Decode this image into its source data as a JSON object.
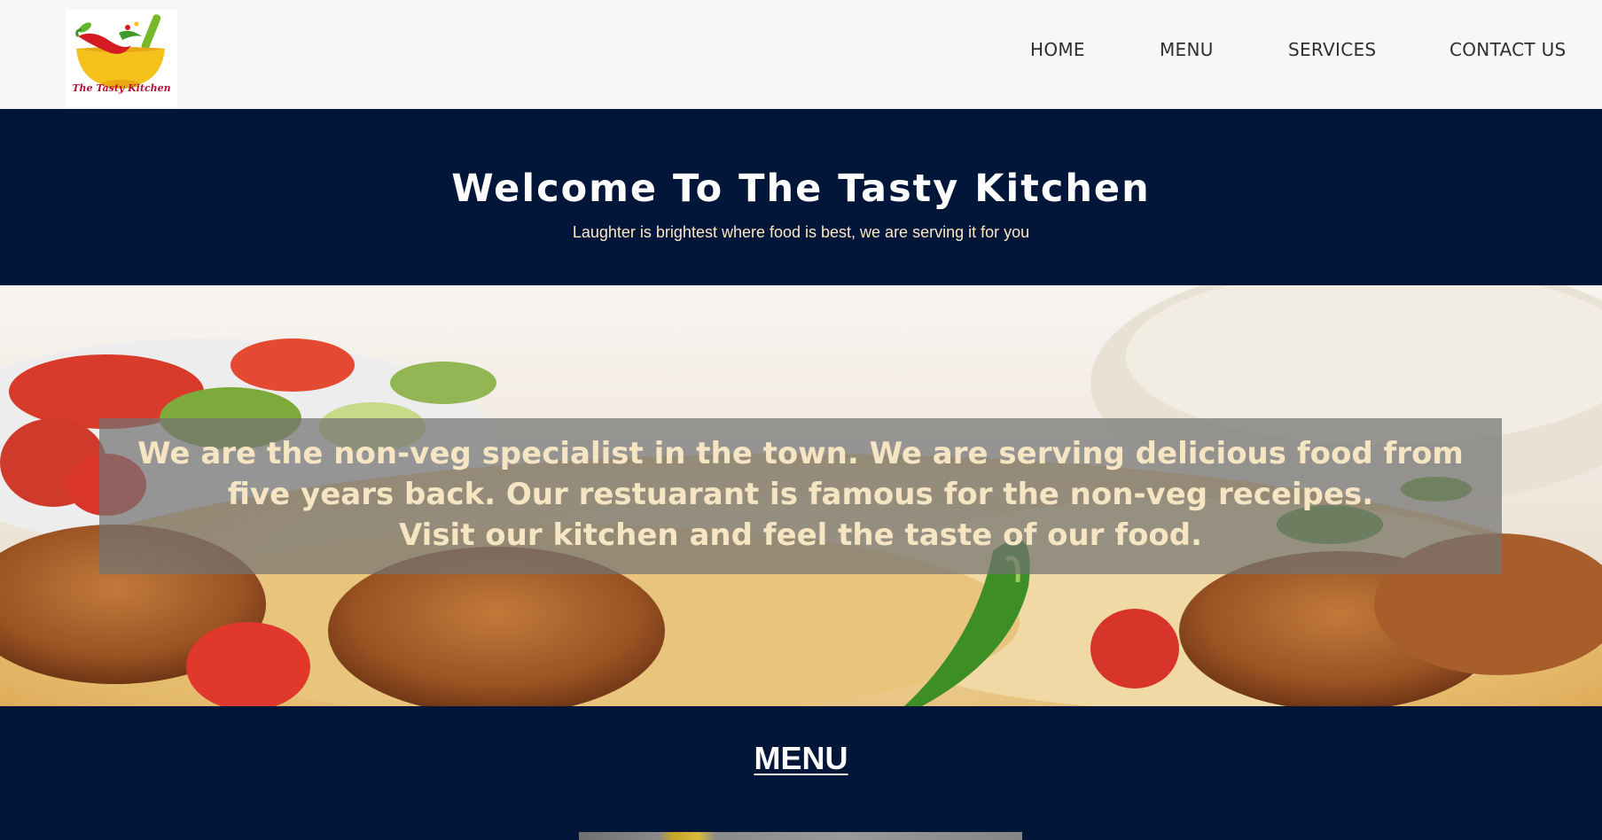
{
  "logo": {
    "text": "The Tasty Kitchen",
    "icon": "bowl-with-chili-logo-icon"
  },
  "nav": {
    "home": "HOME",
    "menu": "MENU",
    "services": "SERVICES",
    "contact": "CONTACT US"
  },
  "welcome": {
    "title": "Welcome To The Tasty Kitchen",
    "subtitle": "Laughter is brightest where food is best, we are serving it for you"
  },
  "hero": {
    "line1": "We are the non-veg specialist in the town. We are serving delicious food from",
    "line2": "five years back. Our restuarant is famous for the non-veg receipes.",
    "line3": "Visit our kitchen and feel the taste of our food."
  },
  "menu_section": {
    "heading": "MENU"
  },
  "colors": {
    "navbar_bg": "#f7f7f7",
    "section_bg": "#02163a",
    "hero_text": "#f6e5c2",
    "subtitle_text": "#fde6c4"
  }
}
